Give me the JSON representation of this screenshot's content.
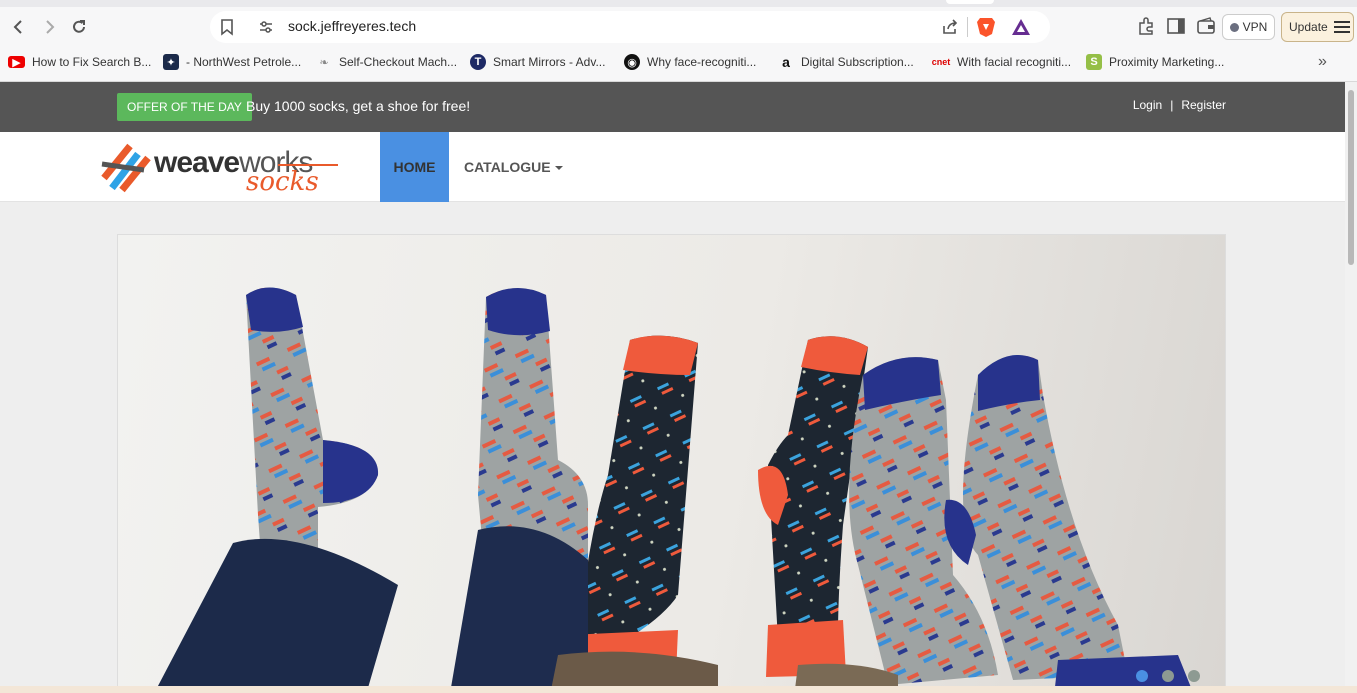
{
  "browser": {
    "url": "sock.jeffreyeres.tech",
    "vpn_label": "VPN",
    "update_label": "Update",
    "bookmarks": [
      {
        "label": "How to Fix Search B...",
        "icon": "youtube-icon"
      },
      {
        "label": "- NorthWest Petrole...",
        "icon": "northwest-icon"
      },
      {
        "label": "Self-Checkout Mach...",
        "icon": "feather-icon"
      },
      {
        "label": "Smart Mirrors - Adv...",
        "icon": "t-circle-icon"
      },
      {
        "label": "Why face-recogniti...",
        "icon": "eye-icon"
      },
      {
        "label": "Digital Subscription...",
        "icon": "amazon-icon"
      },
      {
        "label": "With facial recogniti...",
        "icon": "cnet-icon"
      },
      {
        "label": "Proximity Marketing...",
        "icon": "shopify-icon"
      }
    ],
    "more_label": "»"
  },
  "site": {
    "offer_badge": "OFFER OF THE DAY",
    "offer_text": "Buy 1000 socks, get a shoe for free!",
    "login": "Login",
    "pipe": "|",
    "register": "Register",
    "logo_word_1": "weave",
    "logo_word_2": "works",
    "logo_word_3": "socks",
    "nav_home": "HOME",
    "nav_catalogue": "CATALOGUE",
    "carousel": {
      "slides": 3,
      "active": 1
    },
    "colors": {
      "offer_bar": "#555555",
      "badge": "#5cb85c",
      "home_active": "#4a90e2",
      "brand_orange": "#e95a2b"
    }
  }
}
